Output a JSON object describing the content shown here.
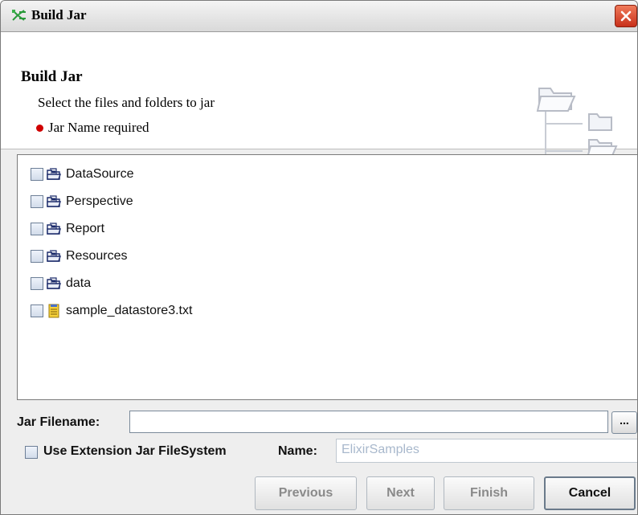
{
  "window": {
    "title": "Build Jar"
  },
  "header": {
    "title": "Build Jar",
    "description": "Select the files and folders to jar",
    "error": "Jar Name required"
  },
  "tree": {
    "items": [
      {
        "label": "DataSource",
        "icon": "folder-icon"
      },
      {
        "label": "Perspective",
        "icon": "folder-icon"
      },
      {
        "label": "Report",
        "icon": "folder-icon"
      },
      {
        "label": "Resources",
        "icon": "folder-icon"
      },
      {
        "label": "data",
        "icon": "folder-icon"
      },
      {
        "label": "sample_datastore3.txt",
        "icon": "text-file-icon"
      }
    ]
  },
  "form": {
    "jar_filename_label": "Jar Filename:",
    "jar_filename_value": "",
    "browse_label": "...",
    "use_extension_label": "Use Extension Jar FileSystem",
    "use_extension_checked": false,
    "name_label": "Name:",
    "name_placeholder": "ElixirSamples"
  },
  "buttons": {
    "previous": "Previous",
    "next": "Next",
    "finish": "Finish",
    "cancel": "Cancel"
  },
  "colors": {
    "error_dot": "#d00000",
    "close_button": "#c8301a",
    "disabled_text": "#8a8a8a"
  }
}
